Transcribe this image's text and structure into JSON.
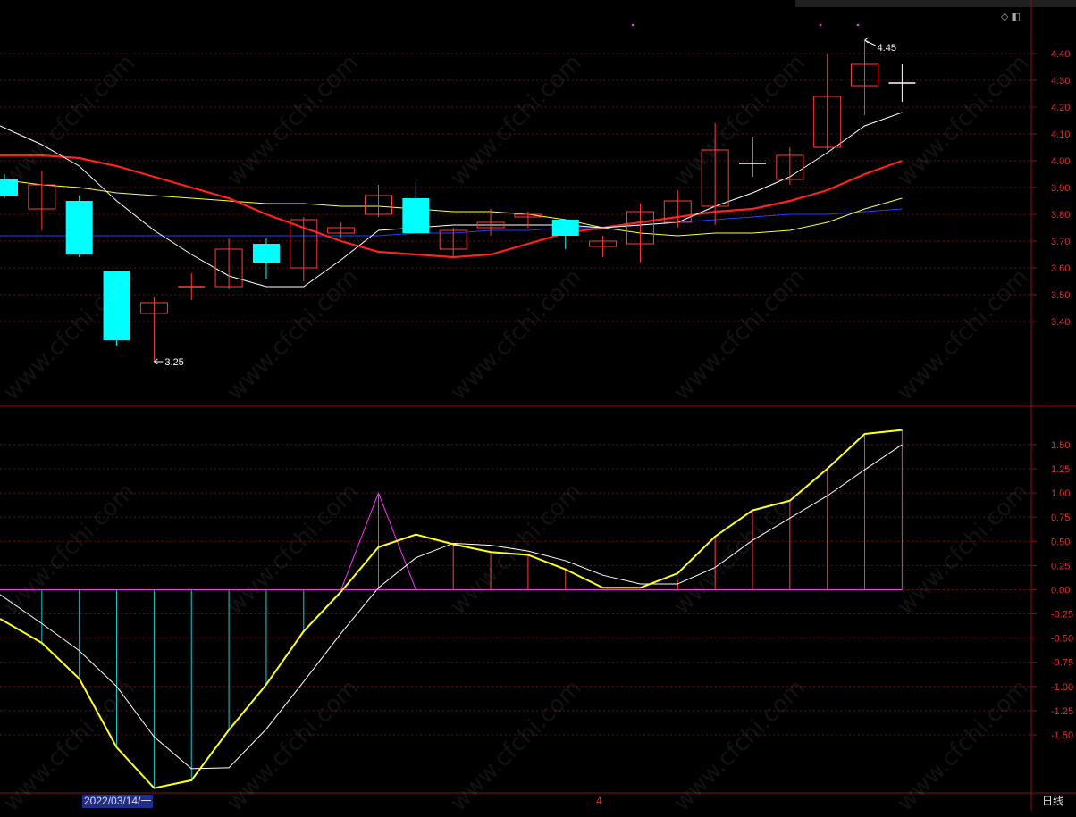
{
  "chart_data": [
    {
      "type": "candlestick",
      "annotations": {
        "high_label": "4.45",
        "low_label": "3.25"
      },
      "y_ticks": [
        "4.40",
        "4.30",
        "4.20",
        "4.10",
        "4.00",
        "3.90",
        "3.80",
        "3.70",
        "3.60",
        "3.50",
        "3.40"
      ],
      "ylim": [
        3.2,
        4.5
      ],
      "colors": {
        "up": "#ff3c3c",
        "down": "#00ffff",
        "ma5": "#ffffff",
        "ma10": "#ffff40",
        "ma20": "#ff2020",
        "ma60": "#2040ff"
      },
      "candles": [
        {
          "o": 3.93,
          "h": 3.95,
          "l": 3.86,
          "c": 3.87
        },
        {
          "o": 3.82,
          "h": 3.96,
          "l": 3.74,
          "c": 3.91
        },
        {
          "o": 3.85,
          "h": 3.87,
          "l": 3.64,
          "c": 3.65
        },
        {
          "o": 3.59,
          "h": 3.59,
          "l": 3.31,
          "c": 3.33
        },
        {
          "o": 3.43,
          "h": 3.49,
          "l": 3.25,
          "c": 3.47
        },
        {
          "o": 3.53,
          "h": 3.58,
          "l": 3.48,
          "c": 3.53
        },
        {
          "o": 3.53,
          "h": 3.71,
          "l": 3.52,
          "c": 3.67
        },
        {
          "o": 3.69,
          "h": 3.71,
          "l": 3.56,
          "c": 3.62
        },
        {
          "o": 3.6,
          "h": 3.79,
          "l": 3.55,
          "c": 3.78
        },
        {
          "o": 3.73,
          "h": 3.77,
          "l": 3.71,
          "c": 3.75
        },
        {
          "o": 3.8,
          "h": 3.91,
          "l": 3.79,
          "c": 3.87
        },
        {
          "o": 3.86,
          "h": 3.92,
          "l": 3.73,
          "c": 3.73
        },
        {
          "o": 3.67,
          "h": 3.75,
          "l": 3.64,
          "c": 3.74
        },
        {
          "o": 3.75,
          "h": 3.82,
          "l": 3.72,
          "c": 3.77
        },
        {
          "o": 3.79,
          "h": 3.81,
          "l": 3.75,
          "c": 3.8
        },
        {
          "o": 3.78,
          "h": 3.78,
          "l": 3.67,
          "c": 3.72
        },
        {
          "o": 3.68,
          "h": 3.72,
          "l": 3.64,
          "c": 3.7
        },
        {
          "o": 3.69,
          "h": 3.84,
          "l": 3.62,
          "c": 3.81
        },
        {
          "o": 3.77,
          "h": 3.89,
          "l": 3.75,
          "c": 3.85
        },
        {
          "o": 3.83,
          "h": 4.14,
          "l": 3.76,
          "c": 4.04
        },
        {
          "o": 3.99,
          "h": 4.09,
          "l": 3.94,
          "c": 3.99
        },
        {
          "o": 3.93,
          "h": 4.05,
          "l": 3.91,
          "c": 4.02
        },
        {
          "o": 4.05,
          "h": 4.4,
          "l": 4.04,
          "c": 4.24
        },
        {
          "o": 4.28,
          "h": 4.45,
          "l": 4.17,
          "c": 4.36
        },
        {
          "o": 4.29,
          "h": 4.36,
          "l": 4.22,
          "c": 4.29
        }
      ],
      "ma5": [
        4.13,
        4.06,
        3.98,
        3.85,
        3.74,
        3.65,
        3.57,
        3.53,
        3.53,
        3.63,
        3.74,
        3.75,
        3.76,
        3.76,
        3.76,
        3.76,
        3.75,
        3.76,
        3.77,
        3.83,
        3.88,
        3.94,
        4.03,
        4.13,
        4.18
      ],
      "ma10": [
        3.93,
        3.91,
        3.9,
        3.88,
        3.87,
        3.86,
        3.85,
        3.84,
        3.84,
        3.83,
        3.83,
        3.82,
        3.81,
        3.81,
        3.8,
        3.78,
        3.75,
        3.73,
        3.72,
        3.73,
        3.73,
        3.74,
        3.77,
        3.82,
        3.86
      ],
      "ma20": [
        4.02,
        4.02,
        4.01,
        3.98,
        3.94,
        3.9,
        3.86,
        3.8,
        3.75,
        3.7,
        3.66,
        3.65,
        3.64,
        3.65,
        3.69,
        3.73,
        3.75,
        3.77,
        3.79,
        3.81,
        3.82,
        3.85,
        3.89,
        3.95,
        4.0
      ],
      "ma60": [
        3.72,
        3.72,
        3.72,
        3.72,
        3.72,
        3.72,
        3.72,
        3.72,
        3.72,
        3.72,
        3.72,
        3.73,
        3.73,
        3.74,
        3.74,
        3.75,
        3.75,
        3.76,
        3.77,
        3.78,
        3.79,
        3.8,
        3.8,
        3.81,
        3.82
      ]
    },
    {
      "type": "macd",
      "y_ticks": [
        "1.50",
        "1.25",
        "1.00",
        "0.75",
        "0.50",
        "0.25",
        "0.00",
        "-0.25",
        "-0.50",
        "-0.75",
        "-1.00",
        "-1.25",
        "-1.50"
      ],
      "ylim": [
        -2.1,
        1.85
      ],
      "colors": {
        "positive": "#ff4040",
        "negative": "#20c8d0",
        "dif": "#ffff20",
        "dea": "#ffffff",
        "spike": "#ff30ff"
      },
      "dif": [
        -0.3,
        -0.55,
        -0.92,
        -1.63,
        -2.05,
        -1.97,
        -1.45,
        -0.98,
        -0.43,
        -0.02,
        0.44,
        0.57,
        0.47,
        0.39,
        0.36,
        0.21,
        0.02,
        0.02,
        0.17,
        0.55,
        0.82,
        0.92,
        1.25,
        1.61,
        1.65
      ],
      "dea": [
        -0.05,
        -0.35,
        -0.63,
        -1.0,
        -1.52,
        -1.85,
        -1.84,
        -1.44,
        -0.95,
        -0.45,
        0.02,
        0.33,
        0.48,
        0.46,
        0.4,
        0.3,
        0.15,
        0.06,
        0.06,
        0.23,
        0.51,
        0.74,
        0.97,
        1.24,
        1.5
      ],
      "hist": [
        null,
        -0.55,
        -0.9,
        -1.63,
        -2.05,
        -1.97,
        -1.45,
        -0.98,
        -0.43,
        0,
        1.0,
        0,
        0.47,
        0.39,
        0.36,
        0.21,
        0,
        0,
        0.1,
        0.55,
        0.82,
        0.92,
        1.25,
        1.61,
        1.65
      ],
      "spike": [
        0.0,
        1.0,
        0.0
      ]
    }
  ],
  "ui": {
    "date_label": "2022/03/14/一",
    "bottom_marker": "4",
    "period_label": "日线",
    "watermark": "www.cfchi.com",
    "corner_icons": "◇ ◧"
  }
}
